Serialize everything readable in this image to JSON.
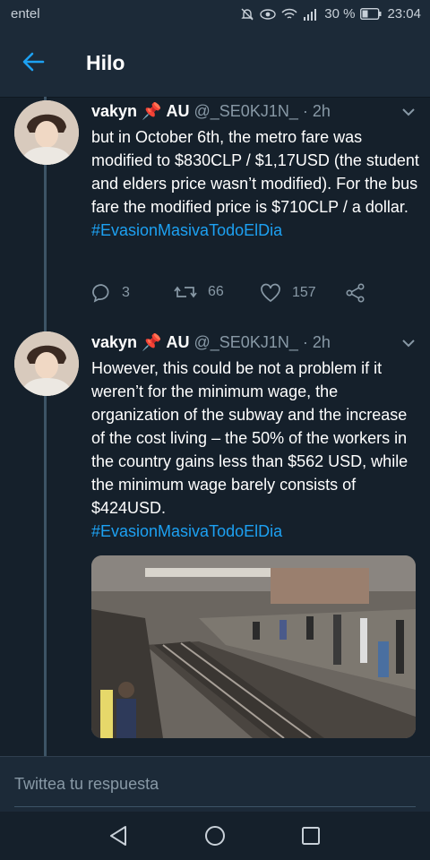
{
  "status": {
    "carrier": "entel",
    "battery": "30 %",
    "time": "23:04"
  },
  "header": {
    "title": "Hilo"
  },
  "tweets": [
    {
      "name": "vakyn",
      "emoji": "📌",
      "name_suffix": "AU",
      "handle": "@_SE0KJ1N_",
      "dot": "·",
      "time": "2h",
      "text": "but in October 6th, the metro fare was modified to $830CLP / $1,17USD (the student and elders price wasn’t modified). For the bus fare the modified price is $710CLP / a dollar.",
      "hashtag": "#EvasionMasivaTodoElDia",
      "replies": "3",
      "retweets": "66",
      "likes": "157"
    },
    {
      "name": "vakyn",
      "emoji": "📌",
      "name_suffix": "AU",
      "handle": "@_SE0KJ1N_",
      "dot": "·",
      "time": "2h",
      "text": "However, this could be not a problem if it weren’t for the minimum wage, the organization of the subway and the increase of the cost living – the 50% of the workers in the country gains less than $562 USD, while the minimum wage barely consists of $424USD.",
      "hashtag": "#EvasionMasivaTodoElDia"
    }
  ],
  "reply": {
    "placeholder": "Twittea tu respuesta"
  },
  "colors": {
    "background": "#15202b",
    "bar": "#1c2a38",
    "accent": "#1da1f2",
    "muted": "#8899a6"
  },
  "icons": [
    "back-arrow-icon",
    "reply-icon",
    "retweet-icon",
    "like-icon",
    "share-icon",
    "chevron-down-icon",
    "nav-back-icon",
    "nav-home-icon",
    "nav-recents-icon"
  ]
}
